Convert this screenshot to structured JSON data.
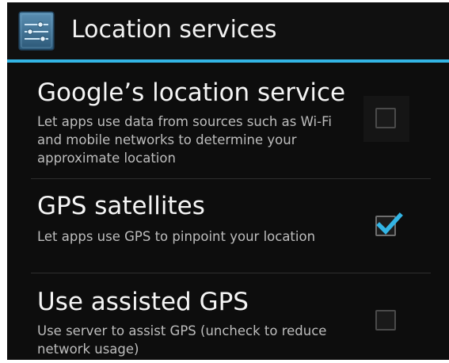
{
  "action_bar": {
    "title": "Location services",
    "icon": "settings-sliders-icon"
  },
  "preferences": [
    {
      "title": "Google’s location service",
      "summary": "Let apps use data from sources such as Wi-Fi and mobile networks to determine your approximate location",
      "checked": false
    },
    {
      "title": "GPS satellites",
      "summary": "Let apps use GPS to pinpoint your location",
      "checked": true
    },
    {
      "title": "Use assisted GPS",
      "summary": "Use server to assist GPS (uncheck to reduce network usage)",
      "checked": false
    }
  ],
  "colors": {
    "accent": "#33b5e5",
    "background": "#0d0d0d",
    "title_text": "#f5f5f5",
    "summary_text": "#bdbdbd"
  }
}
